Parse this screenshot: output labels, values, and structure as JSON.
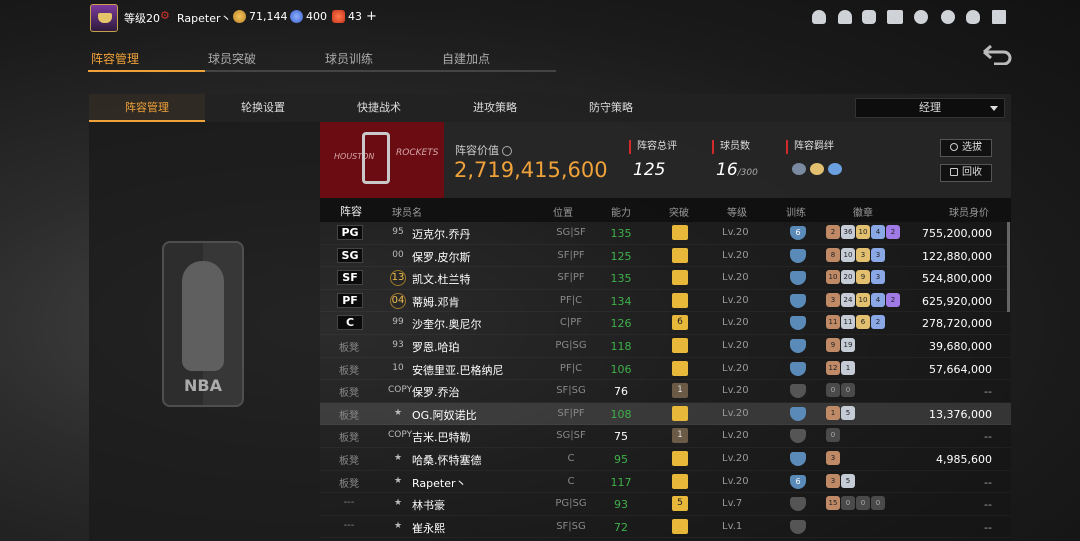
{
  "topbar": {
    "level": "等级20",
    "username": "Rapeter丶",
    "currencies": [
      {
        "icon": "gold-coin-icon",
        "value": "71,144"
      },
      {
        "icon": "blue-star-icon",
        "value": "400"
      },
      {
        "icon": "red-d-icon",
        "value": "43"
      }
    ],
    "plus": "+"
  },
  "main_tabs": [
    "阵容管理",
    "球员突破",
    "球员训练",
    "自建加点"
  ],
  "sub_tabs": [
    "阵容管理",
    "轮换设置",
    "快捷战术",
    "进攻策略",
    "防守策略"
  ],
  "dropdown": {
    "value": "经理"
  },
  "team": {
    "logo_text_left": "HOUSTON",
    "logo_text_right": "ROCKETS",
    "value_label": "阵容价值",
    "value": "2,719,415,600",
    "rating_label": "阵容总评",
    "rating": "125",
    "player_count_label": "球员数",
    "player_count": "16",
    "player_count_max": "/300",
    "bonds_label": "阵容羁绊",
    "btn_select": "选拔",
    "btn_recycle": "回收"
  },
  "table": {
    "headers": [
      "阵容",
      "球员名",
      "位置",
      "能力",
      "突破",
      "等级",
      "训练",
      "徽章",
      "球员身价"
    ],
    "rows": [
      {
        "slot": "PG",
        "num": "95",
        "name": "迈克尔.乔丹",
        "pos": "SG|SF",
        "power": "135",
        "brk": "",
        "level": "Lv.20",
        "train": "6",
        "badges": [
          "2",
          "36",
          "10",
          "4",
          "2"
        ],
        "price": "755,200,000"
      },
      {
        "slot": "SG",
        "num": "00",
        "name": "保罗.皮尔斯",
        "pos": "SF|PF",
        "power": "125",
        "brk": "",
        "level": "Lv.20",
        "train": "",
        "badges": [
          "8",
          "10",
          "3",
          "3"
        ],
        "price": "122,880,000"
      },
      {
        "slot": "SF",
        "num": "13",
        "name": "凯文.杜兰特",
        "pos": "SF|PF",
        "power": "135",
        "brk": "",
        "level": "Lv.20",
        "train": "",
        "badges": [
          "10",
          "20",
          "9",
          "3"
        ],
        "price": "524,800,000"
      },
      {
        "slot": "PF",
        "num": "04",
        "name": "蒂姆.邓肯",
        "pos": "PF|C",
        "power": "134",
        "brk": "",
        "level": "Lv.20",
        "train": "",
        "badges": [
          "3",
          "24",
          "10",
          "4",
          "2"
        ],
        "price": "625,920,000"
      },
      {
        "slot": "C",
        "num": "99",
        "name": "沙奎尔.奥尼尔",
        "pos": "C|PF",
        "power": "126",
        "brk": "6",
        "level": "Lv.20",
        "train": "",
        "badges": [
          "11",
          "11",
          "6",
          "2"
        ],
        "price": "278,720,000"
      },
      {
        "slot": "板凳",
        "num": "93",
        "name": "罗恩.哈珀",
        "pos": "PG|SG",
        "power": "118",
        "brk": "",
        "level": "Lv.20",
        "train": "",
        "badges": [
          "9",
          "19"
        ],
        "price": "39,680,000"
      },
      {
        "slot": "板凳",
        "num": "10",
        "name": "安德里亚.巴格纳尼",
        "pos": "PF|C",
        "power": "106",
        "brk": "",
        "level": "Lv.20",
        "train": "",
        "badges": [
          "12",
          "1"
        ],
        "price": "57,664,000"
      },
      {
        "slot": "板凳",
        "num": "COPY",
        "name": "保罗.乔治",
        "pos": "SF|SG",
        "power": "76",
        "brk": "1",
        "level": "Lv.20",
        "train": "",
        "badges": [
          "0",
          "0"
        ],
        "price": "--"
      },
      {
        "slot": "板凳",
        "num": "",
        "name": "OG.阿奴诺比",
        "pos": "SF|PF",
        "power": "108",
        "brk": "",
        "level": "Lv.20",
        "train": "",
        "badges": [
          "1",
          "5"
        ],
        "price": "13,376,000"
      },
      {
        "slot": "板凳",
        "num": "COPY",
        "name": "吉米.巴特勒",
        "pos": "SG|SF",
        "power": "75",
        "brk": "1",
        "level": "Lv.20",
        "train": "",
        "badges": [
          "0"
        ],
        "price": "--"
      },
      {
        "slot": "板凳",
        "num": "",
        "name": "哈桑.怀特塞德",
        "pos": "C",
        "power": "95",
        "brk": "",
        "level": "Lv.20",
        "train": "",
        "badges": [
          "3"
        ],
        "price": "4,985,600"
      },
      {
        "slot": "板凳",
        "num": "",
        "name": "Rapeter丶",
        "pos": "C",
        "power": "117",
        "brk": "",
        "level": "Lv.20",
        "train": "6",
        "badges": [
          "3",
          "5"
        ],
        "price": "--"
      },
      {
        "slot": "---",
        "num": "",
        "name": "林书豪",
        "pos": "PG|SG",
        "power": "93",
        "brk": "5",
        "level": "Lv.7",
        "train": "",
        "badges": [
          "15",
          "0",
          "0",
          "0"
        ],
        "price": "--"
      },
      {
        "slot": "---",
        "num": "",
        "name": "崔永熙",
        "pos": "SF|SG",
        "power": "72",
        "brk": "",
        "level": "Lv.1",
        "train": "",
        "badges": [],
        "price": "--"
      }
    ]
  },
  "colors": {
    "accent": "#f0a23a",
    "green": "#3fb04a",
    "red": "#d02a2a"
  }
}
